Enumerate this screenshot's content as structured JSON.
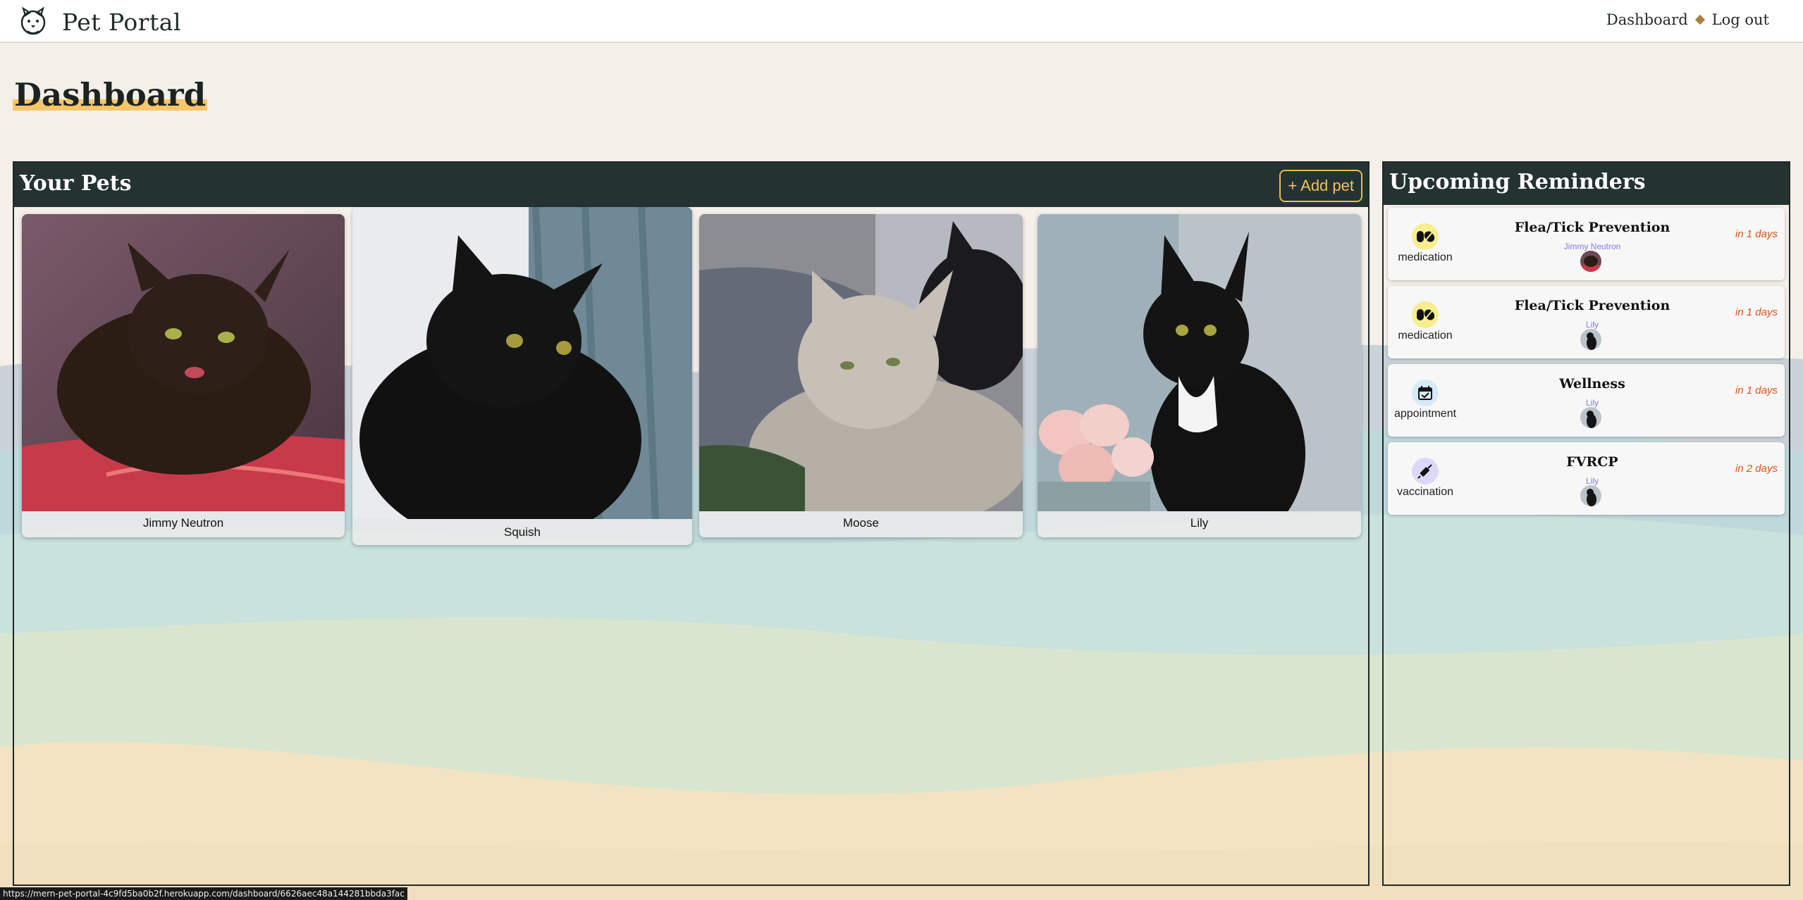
{
  "app": {
    "brand": "Pet Portal",
    "nav": {
      "dashboard": "Dashboard",
      "logout": "Log out"
    }
  },
  "page": {
    "title": "Dashboard"
  },
  "pets_panel": {
    "title": "Your Pets",
    "add_button": "+ Add pet",
    "pets": [
      {
        "name": "Jimmy Neutron"
      },
      {
        "name": "Squish"
      },
      {
        "name": "Moose"
      },
      {
        "name": "Lily"
      }
    ]
  },
  "reminders_panel": {
    "title": "Upcoming Reminders",
    "reminders": [
      {
        "type": "medication",
        "title": "Flea/Tick Prevention",
        "pet": "Jimmy Neutron",
        "due": "in 1 days",
        "icon": "pill-icon"
      },
      {
        "type": "medication",
        "title": "Flea/Tick Prevention",
        "pet": "Lily",
        "due": "in 1 days",
        "icon": "pill-icon"
      },
      {
        "type": "appointment",
        "title": "Wellness",
        "pet": "Lily",
        "due": "in 1 days",
        "icon": "calendar-check-icon"
      },
      {
        "type": "vaccination",
        "title": "FVRCP",
        "pet": "Lily",
        "due": "in 2 days",
        "icon": "syringe-icon"
      }
    ]
  },
  "status_bar": {
    "url": "https://mern-pet-portal-4c9fd5ba0b2f.herokuapp.com/dashboard/6626aec48a144281bbda3fac"
  },
  "colors": {
    "panel_header": "#243331",
    "accent": "#f2c15e",
    "due_text": "#e0521b",
    "pet_link": "#7f7be8",
    "medication_icon_bg": "#f8ee8c",
    "appointment_icon_bg": "#d6e9f6",
    "vaccination_icon_bg": "#dcd9f7"
  }
}
